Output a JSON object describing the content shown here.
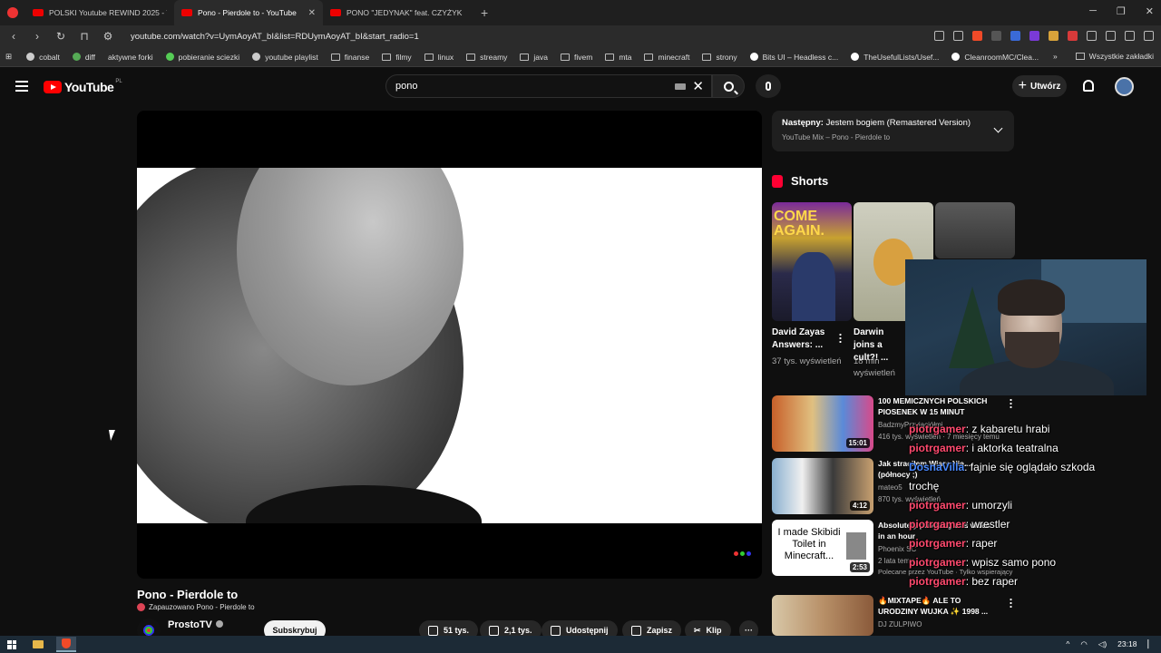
{
  "browser": {
    "tabs": [
      {
        "title": "POLSKI Youtube REWIND 2025 - Yo",
        "active": false
      },
      {
        "title": "Pono - Pierdole to - YouTube",
        "active": true
      },
      {
        "title": "PONO \"JEDYNAK\" feat. CZYŻYK prod",
        "active": false
      }
    ],
    "new_tab": "+",
    "url": "youtube.com/watch?v=UymAoyAT_bI&list=RDUymAoyAT_bI&start_radio=1",
    "bookmarks": [
      "cobalt",
      "diff",
      "aktywne forki",
      "pobieranie sciezki",
      "youtube playlist",
      "finanse",
      "filmy",
      "linux",
      "streamy",
      "java",
      "fivem",
      "mta",
      "minecraft",
      "strony",
      "Bits UI – Headless c...",
      "TheUsefulLists/Usef...",
      "CleanroomMC/Clea..."
    ],
    "bookmarks_more": "»",
    "all_bookmarks": "Wszystkie zakładki"
  },
  "youtube": {
    "logo_text": "YouTube",
    "logo_country": "PL",
    "search_value": "pono",
    "create_label": "Utwórz",
    "video": {
      "title": "Pono - Pierdole to",
      "paused_label": "Zapauzowano Pono - Pierdole to",
      "channel": "ProstoTV",
      "subscribe_label": "Subskrybuj",
      "likes": "51 tys.",
      "dislikes": "2,1 tys.",
      "share_label": "Udostępnij",
      "save_label": "Zapisz",
      "clip_label": "Klip",
      "more_label": "···"
    },
    "up_next": {
      "label": "Następny:",
      "title": "Jestem bogiem (Remastered Version)",
      "playlist": "YouTube Mix – Pono - Pierdole to"
    },
    "shorts": {
      "heading": "Shorts",
      "items": [
        {
          "title": "David Zayas Answers: ...",
          "views": "37 tys. wyświetleń",
          "thumb_text": "COME AGAIN."
        },
        {
          "title": "Darwin joins a cult?! ...",
          "views": "18 mln wyświetleń",
          "thumb_text": ""
        },
        {
          "title": "",
          "views": "",
          "thumb_text": ""
        }
      ]
    },
    "recommendations": [
      {
        "title": "100 MEMICZNYCH POLSKICH PIOSENEK W 15 MINUT",
        "channel": "BadzmyPrzyjaciółmi",
        "meta": "416 tys. wyświetleń · 7 miesięcy temu",
        "badge": "",
        "duration": "15:01"
      },
      {
        "title": "Jak straciłem Wiarę Nie... (północy ;)",
        "channel": "mateo5",
        "meta": "870 tys. wyświetleń",
        "badge": "",
        "duration": "4:12"
      },
      {
        "title": "Absolutely privating this video in an hour",
        "channel": "Phoenix SC",
        "meta": "2 lata temu",
        "badge": "Polecane przez YouTube · Tylko wspierający",
        "duration": "2:53",
        "thumb_text": "I made Skibidi Toilet in Minecraft..."
      },
      {
        "title": "🔥MIXTAPE🔥 ALE TO URODZINY WUJKA ✨ 1998 ...",
        "channel": "DJ ZULPIWO",
        "meta": "",
        "badge": "",
        "duration": ""
      }
    ]
  },
  "stream_chat": [
    {
      "user": "piotrgamer",
      "message": ": z kabaretu hrabi"
    },
    {
      "user": "piotrgamer",
      "message": ": i aktorka teatralna"
    },
    {
      "user": "DosnaVilla",
      "message": ": fajnie się oglądało szkoda"
    },
    {
      "user": "",
      "message": "trochę"
    },
    {
      "user": "piotrgamer",
      "message": ": umorzyli"
    },
    {
      "user": "piotrgamer",
      "message": ": wrestler"
    },
    {
      "user": "piotrgamer",
      "message": ": raper"
    },
    {
      "user": "piotrgamer",
      "message": ": wpisz samo pono"
    },
    {
      "user": "piotrgamer",
      "message": ": bez raper"
    }
  ],
  "taskbar": {
    "clock": "23:18"
  }
}
